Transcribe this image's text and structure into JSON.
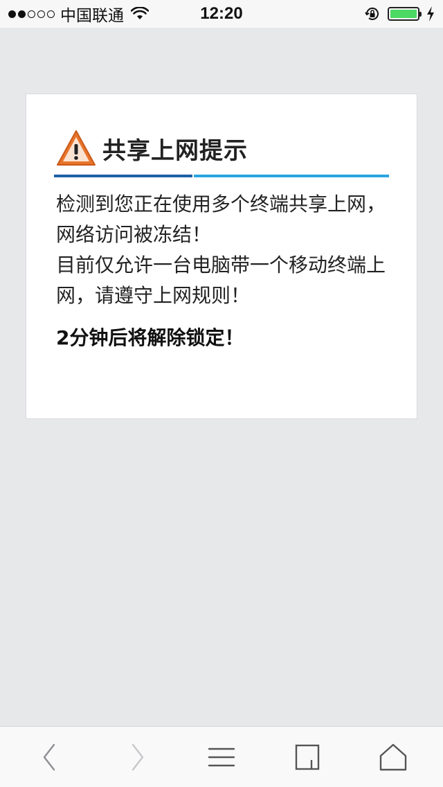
{
  "status_bar": {
    "carrier": "中国联通",
    "time": "12:20"
  },
  "alert": {
    "icon": "warning-triangle-icon",
    "title": "共享上网提示",
    "message_lines": [
      "检测到您正在使用多个终端共享上网，网络访问被冻结！",
      "目前仅允许一台电脑带一个移动终端上网，请遵守上网规则！"
    ],
    "countdown": "2分钟后将解除锁定！",
    "colors": {
      "rule_dark": "#1f5fa6",
      "rule_light": "#2aa5e0",
      "warning": "#e8742b"
    }
  },
  "toolbar": {
    "items": [
      "back-icon",
      "forward-icon",
      "menu-icon",
      "tabs-icon",
      "home-icon"
    ]
  }
}
